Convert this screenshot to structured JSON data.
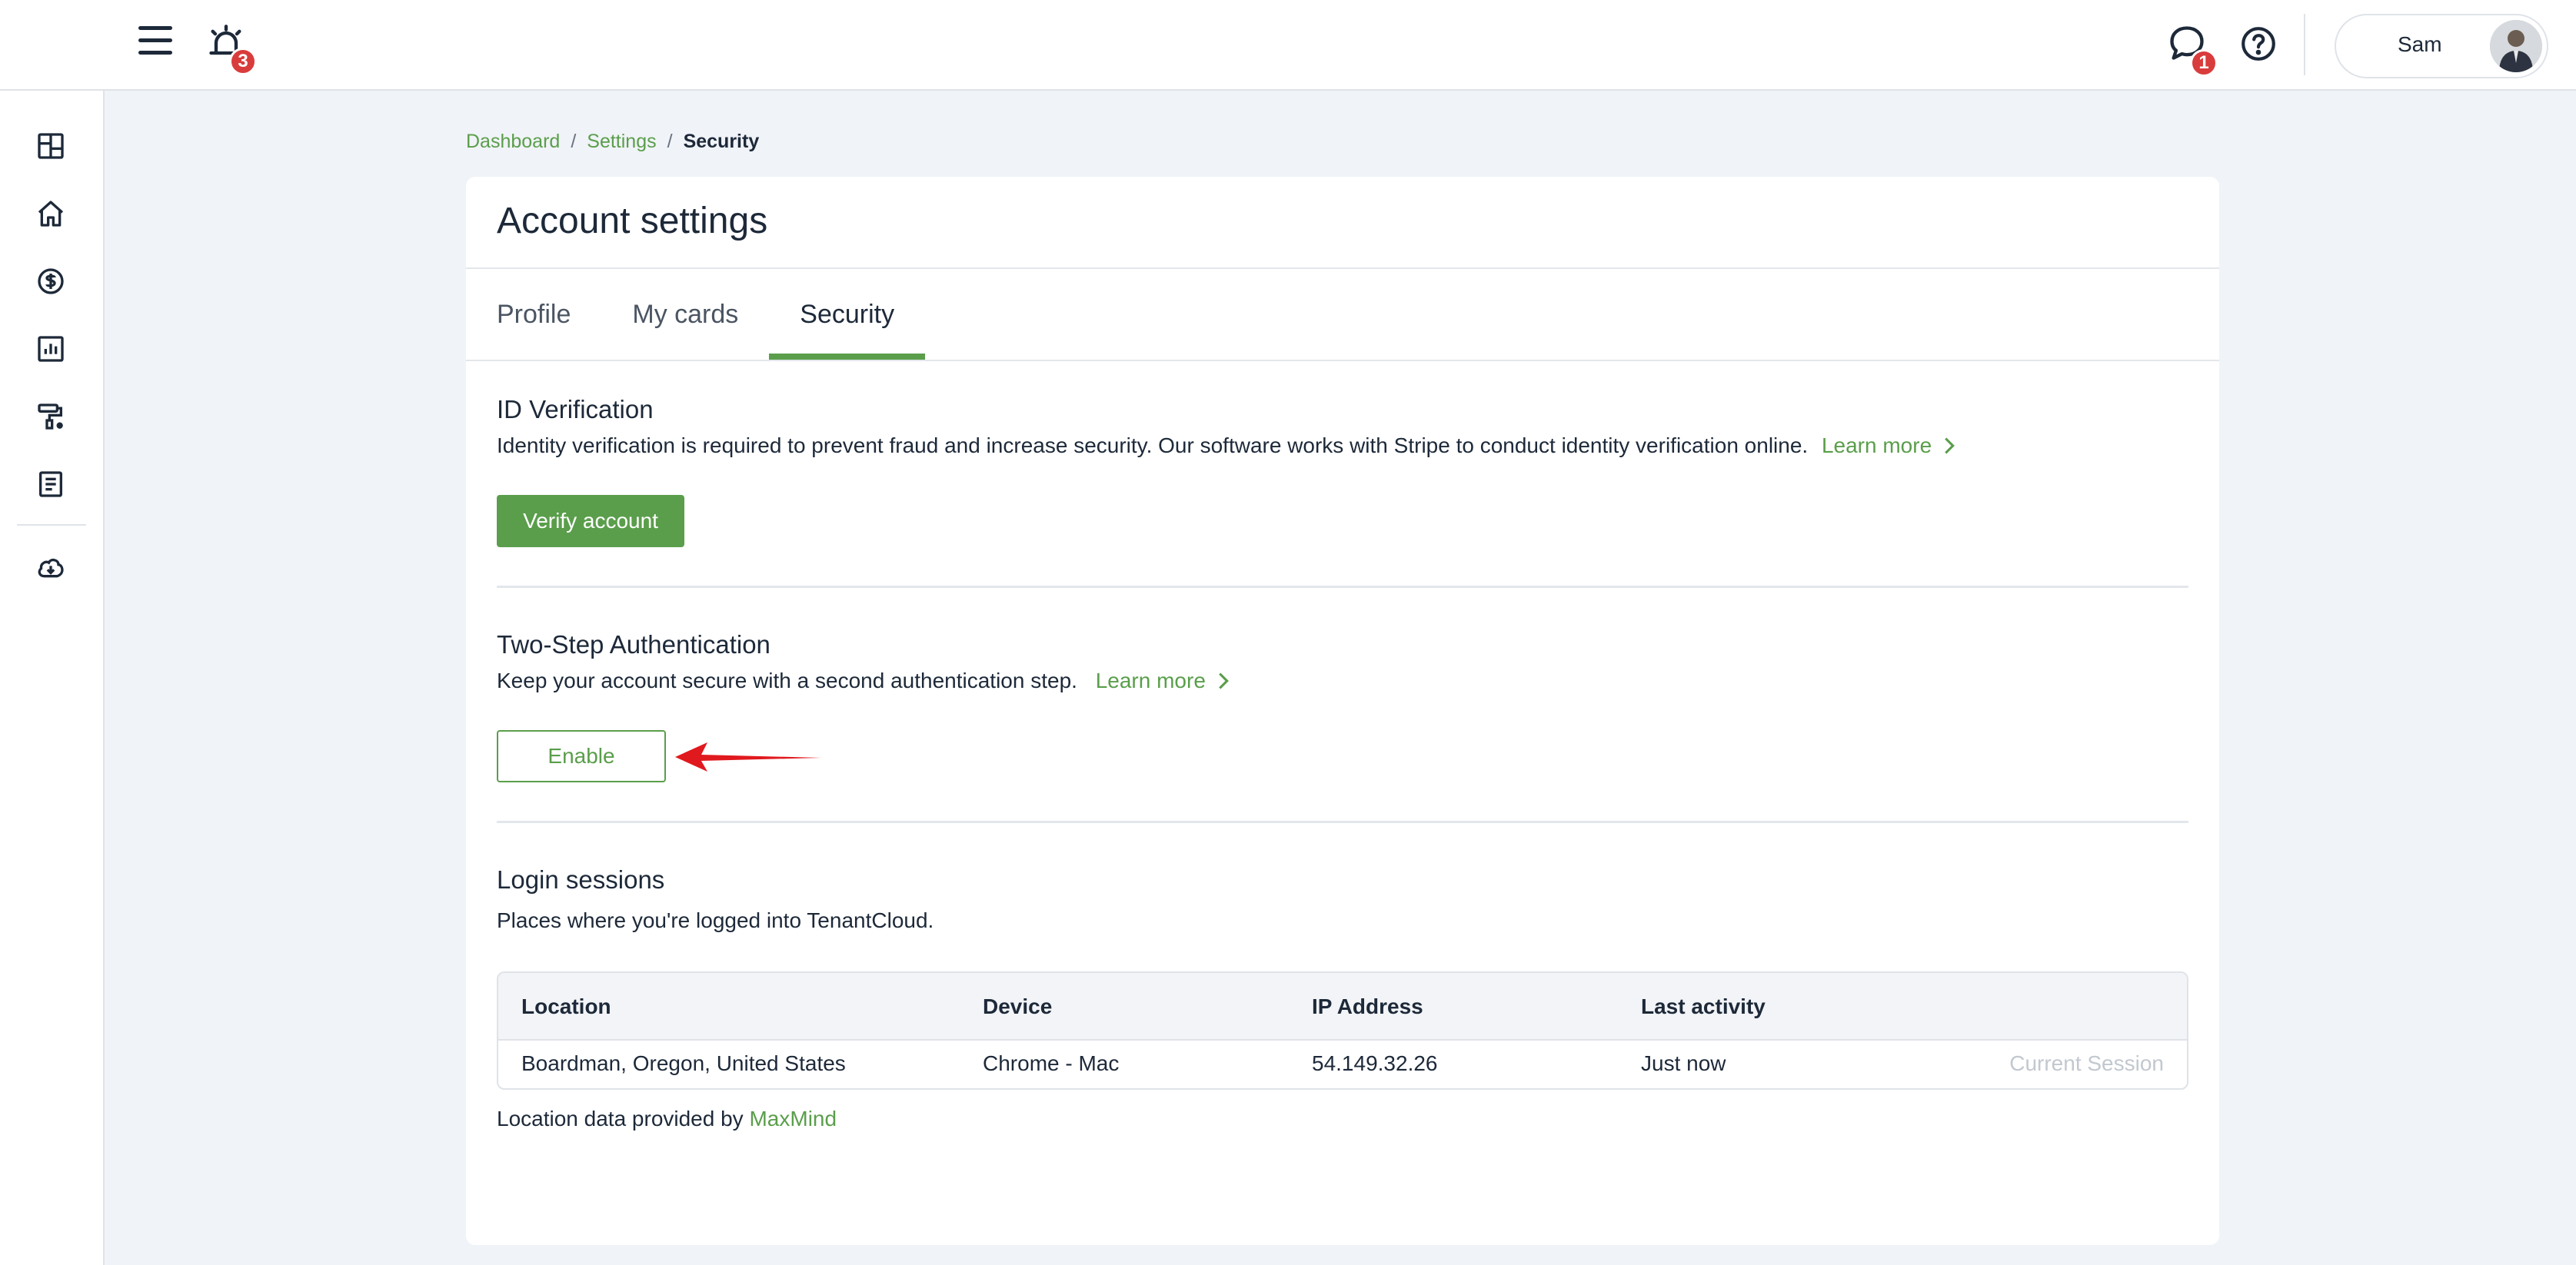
{
  "topbar": {
    "notifications_count": "3",
    "messages_count": "1",
    "user_name": "Sam"
  },
  "breadcrumb": {
    "items": [
      "Dashboard",
      "Settings"
    ],
    "current": "Security",
    "separator": "/"
  },
  "page": {
    "title": "Account settings",
    "tabs": [
      {
        "label": "Profile"
      },
      {
        "label": "My cards"
      },
      {
        "label": "Security"
      }
    ]
  },
  "id_verification": {
    "title": "ID Verification",
    "description": "Identity verification is required to prevent fraud and increase security. Our software works with Stripe to conduct identity verification online.",
    "learn_more": "Learn more",
    "button": "Verify account"
  },
  "two_step": {
    "title": "Two-Step Authentication",
    "description": "Keep your account secure with a second authentication step.",
    "learn_more": "Learn more",
    "button": "Enable"
  },
  "login_sessions": {
    "title": "Login sessions",
    "description": "Places where you're logged into TenantCloud.",
    "columns": [
      "Location",
      "Device",
      "IP Address",
      "Last activity"
    ],
    "rows": [
      {
        "location": "Boardman, Oregon, United States",
        "device": "Chrome - Mac",
        "ip": "54.149.32.26",
        "last_activity": "Just now",
        "status": "Current Session"
      }
    ],
    "provided_by_text": "Location data provided by",
    "provided_by_link": "MaxMind"
  },
  "colors": {
    "accent_green": "#5a9e4b",
    "badge_red": "#d93c3c",
    "annotation_arrow": "#e0191e"
  },
  "icons": {
    "sidebar": [
      "grid-dashboard-icon",
      "home-icon",
      "dollar-coin-icon",
      "bar-chart-icon",
      "paint-roller-icon",
      "document-list-icon",
      "cloud-download-icon"
    ]
  }
}
